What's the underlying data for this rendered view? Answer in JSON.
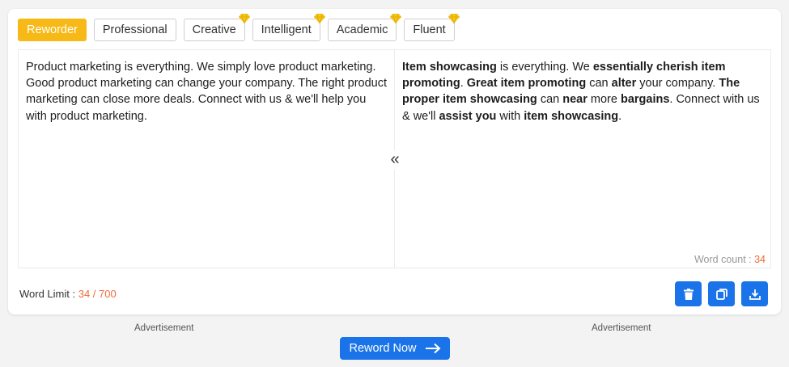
{
  "tabs": [
    {
      "label": "Reworder",
      "premium": false,
      "active": true
    },
    {
      "label": "Professional",
      "premium": false,
      "active": false
    },
    {
      "label": "Creative",
      "premium": true,
      "active": false
    },
    {
      "label": "Intelligent",
      "premium": true,
      "active": false
    },
    {
      "label": "Academic",
      "premium": true,
      "active": false
    },
    {
      "label": "Fluent",
      "premium": true,
      "active": false
    }
  ],
  "input_text": "Product marketing is everything. We simply love product marketing. Good product marketing can change your company. The right product marketing can close more deals. Connect with us & we'll help you with product marketing.",
  "output_segments": [
    {
      "text": "Item showcasing",
      "bold": true
    },
    {
      "text": " is everything. We ",
      "bold": false
    },
    {
      "text": "essentially cherish item promoting",
      "bold": true
    },
    {
      "text": ". ",
      "bold": false
    },
    {
      "text": "Great item promoting",
      "bold": true
    },
    {
      "text": " can ",
      "bold": false
    },
    {
      "text": "alter",
      "bold": true
    },
    {
      "text": " your company. ",
      "bold": false
    },
    {
      "text": "The proper item showcasing",
      "bold": true
    },
    {
      "text": " can ",
      "bold": false
    },
    {
      "text": "near",
      "bold": true
    },
    {
      "text": " more ",
      "bold": false
    },
    {
      "text": "bargains",
      "bold": true
    },
    {
      "text": ". Connect with us & we'll ",
      "bold": false
    },
    {
      "text": "assist you",
      "bold": true
    },
    {
      "text": " with ",
      "bold": false
    },
    {
      "text": "item showcasing",
      "bold": true
    },
    {
      "text": ".",
      "bold": false
    }
  ],
  "swap_icon": "«",
  "word_count": {
    "label": "Word count : ",
    "value": "34"
  },
  "word_limit": {
    "label": "Word Limit : ",
    "value": "34 / 700"
  },
  "actions": [
    {
      "name": "delete-button",
      "icon": "trash-icon"
    },
    {
      "name": "copy-button",
      "icon": "copy-icon"
    },
    {
      "name": "download-button",
      "icon": "download-icon"
    }
  ],
  "ads": {
    "left": "Advertisement",
    "right": "Advertisement"
  },
  "reword_button": {
    "label": "Reword Now"
  },
  "colors": {
    "accent": "#1a73e8",
    "active_tab": "#f7b916",
    "highlight_number": "#f26b3a",
    "premium_gem": "#f5c518"
  }
}
